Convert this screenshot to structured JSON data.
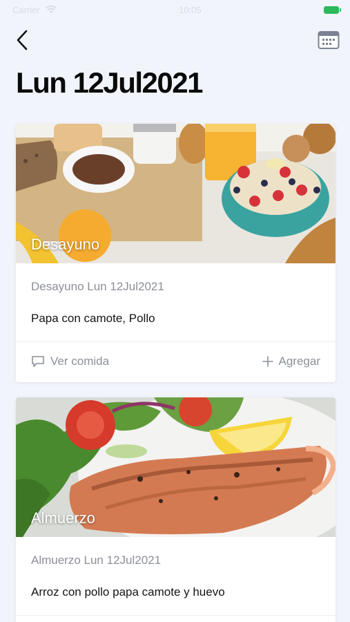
{
  "status_bar": {
    "carrier": "Carrier",
    "time": "10:05"
  },
  "nav": {
    "back_icon": "chevron-left-icon",
    "calendar_icon": "calendar-icon"
  },
  "page": {
    "title": "Lun 12Jul2021"
  },
  "meals": [
    {
      "image_label": "Desayuno",
      "image_subject": "breakfast",
      "meta": "Desayuno Lun 12Jul2021",
      "description": "Papa con camote, Pollo",
      "view_label": "Ver comida",
      "add_label": "Agregar"
    },
    {
      "image_label": "Almuerzo",
      "image_subject": "lunch",
      "meta": "Almuerzo Lun 12Jul2021",
      "description": "Arroz con pollo papa camote y huevo"
    }
  ],
  "colors": {
    "background": "#f1f4fa",
    "battery": "#2eb85c",
    "muted_text": "#8b8f97"
  }
}
